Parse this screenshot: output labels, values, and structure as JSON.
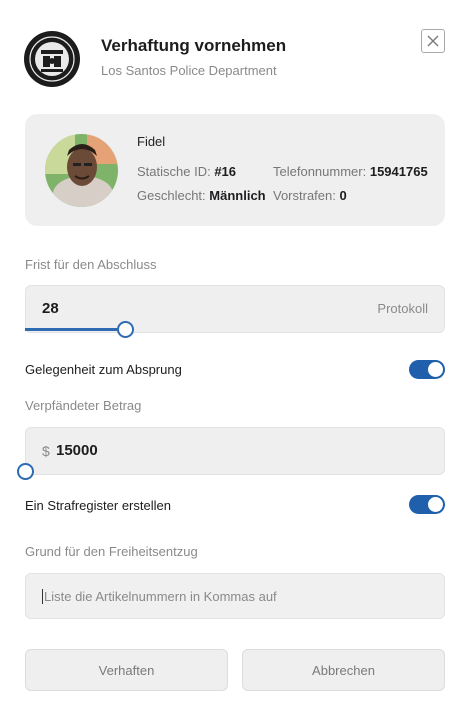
{
  "header": {
    "title": "Verhaftung vornehmen",
    "subtitle": "Los Santos Police Department"
  },
  "profile": {
    "name": "Fidel",
    "static_id_label": "Statische ID:",
    "static_id_value": "#16",
    "phone_label": "Telefonnummer:",
    "phone_value": "15941765",
    "gender_label": "Geschlecht:",
    "gender_value": "Männlich",
    "record_label": "Vorstrafen:",
    "record_value": "0"
  },
  "deadline": {
    "label": "Frist für den Abschluss",
    "value": "28",
    "unit": "Protokoll",
    "slider_fraction": 0.24
  },
  "escape_chance": {
    "label": "Gelegenheit zum Absprung",
    "enabled": true
  },
  "bail": {
    "label": "Verpfändeter Betrag",
    "currency": "$",
    "value": "15000",
    "slider_fraction": 0.0
  },
  "criminal_record": {
    "label": "Ein Strafregister erstellen",
    "enabled": true
  },
  "reason": {
    "label": "Grund für den Freiheitsentzug",
    "placeholder": "Liste die Artikelnummern in Kommas auf"
  },
  "actions": {
    "arrest_label": "Verhaften",
    "cancel_label": "Abbrechen"
  },
  "colors": {
    "accent": "#2f6bb3",
    "toggle_on": "#1f5fab",
    "card_bg": "#efefef"
  },
  "icons": {
    "logo": "lspd-seal-icon",
    "close": "close-icon"
  }
}
